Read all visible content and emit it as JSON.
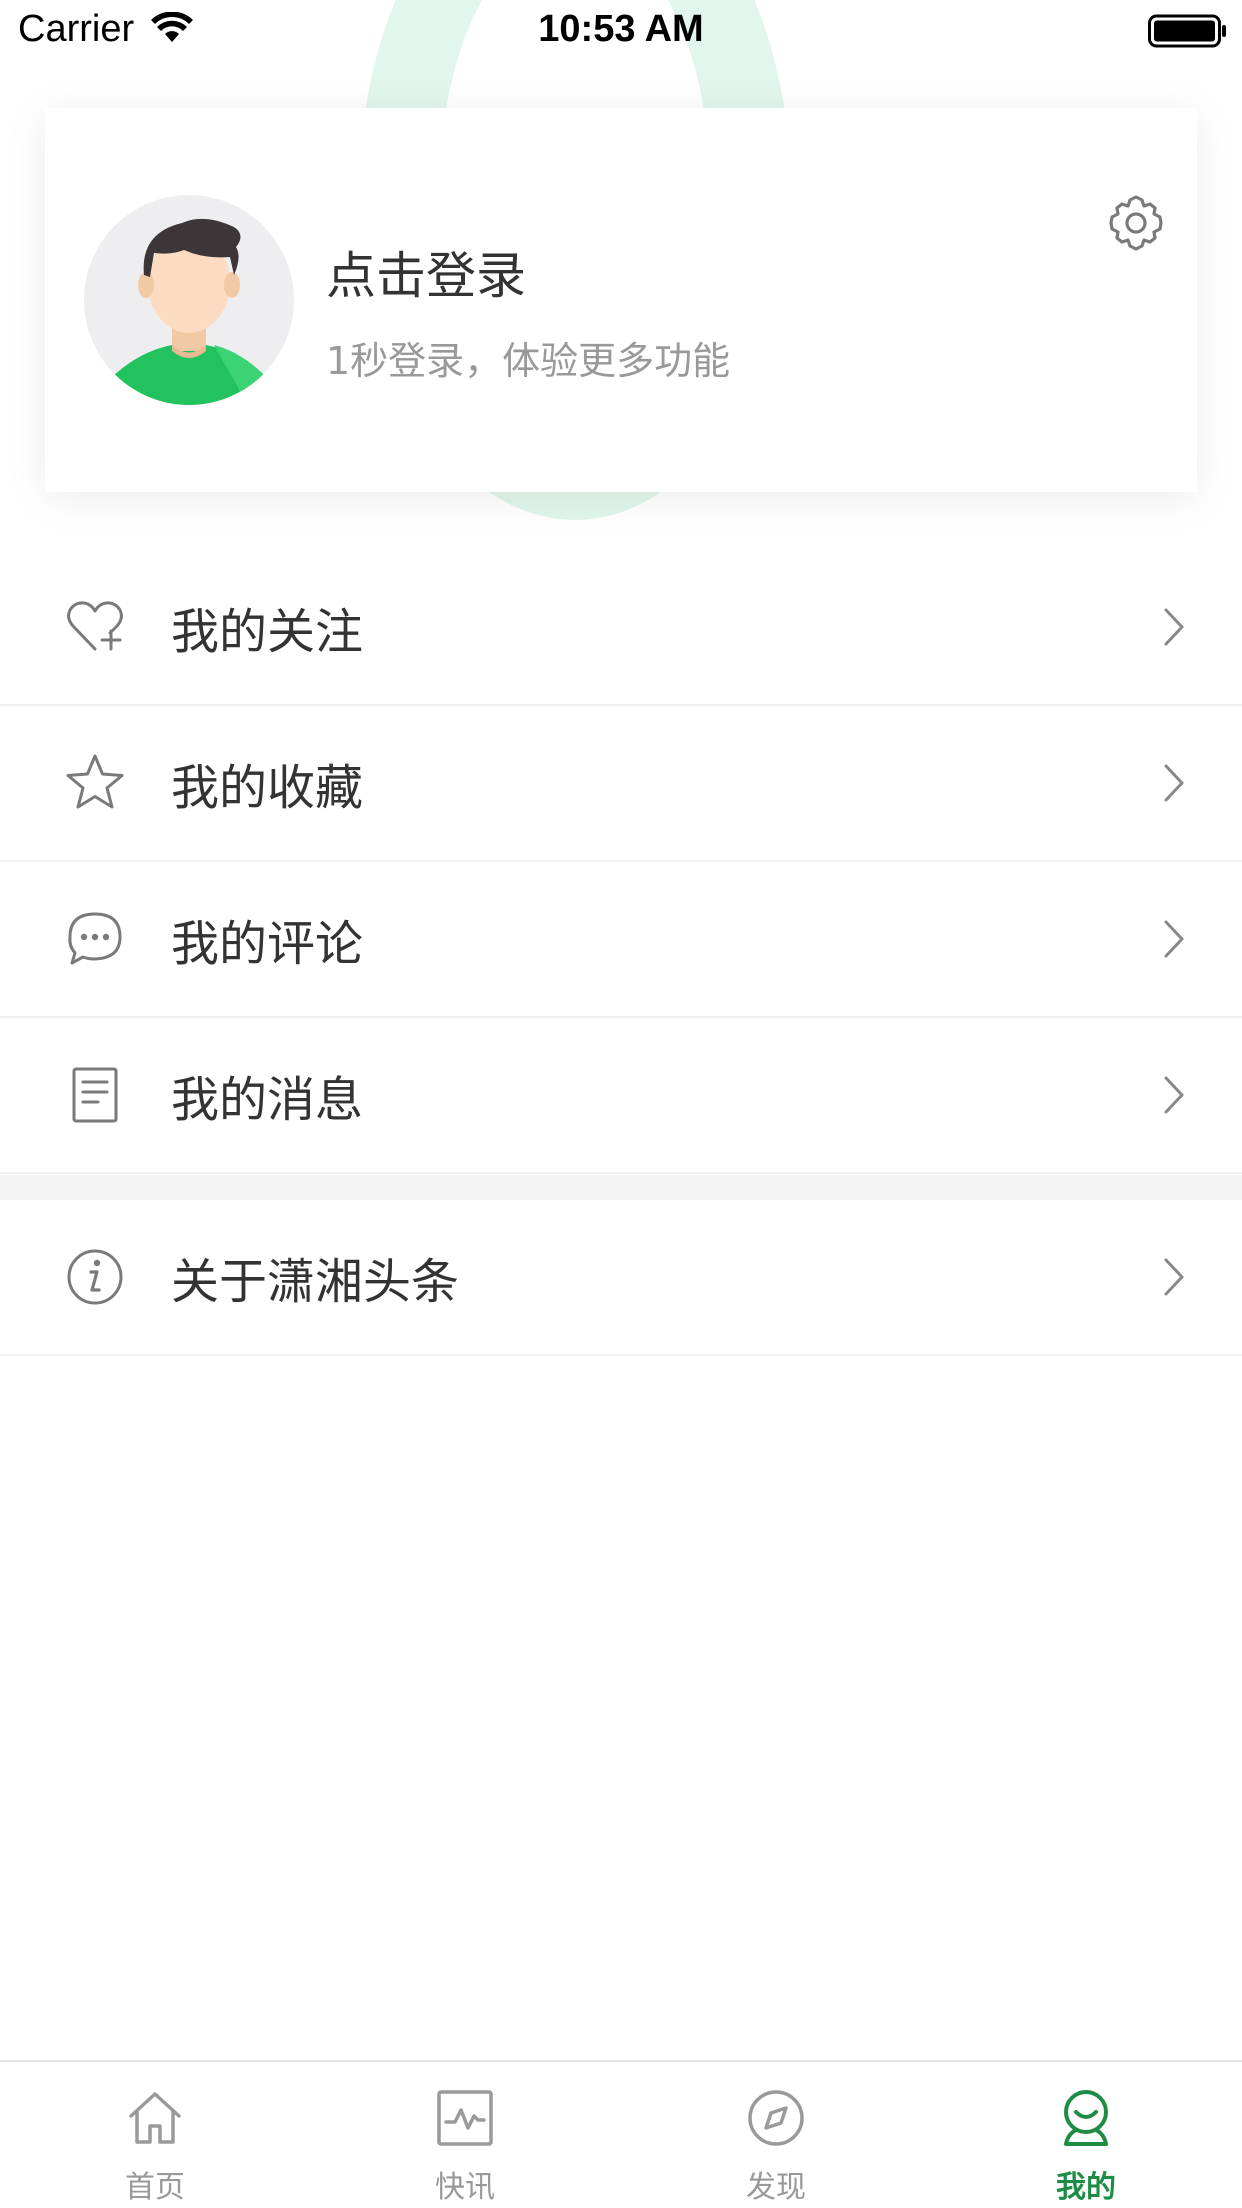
{
  "status_bar": {
    "carrier": "Carrier",
    "time": "10:53 AM"
  },
  "profile": {
    "login_title": "点击登录",
    "login_subtitle": "1秒登录，体验更多功能",
    "settings_icon": "gear-icon",
    "avatar_icon": "default-avatar"
  },
  "menu": {
    "group_main": [
      {
        "label": "我的关注",
        "icon": "heart-plus-icon"
      },
      {
        "label": "我的收藏",
        "icon": "star-icon"
      },
      {
        "label": "我的评论",
        "icon": "comment-icon"
      },
      {
        "label": "我的消息",
        "icon": "document-icon"
      }
    ],
    "group_about": [
      {
        "label": "关于潇湘头条",
        "icon": "info-icon"
      }
    ]
  },
  "tab_bar": {
    "tabs": [
      {
        "label": "首页",
        "icon": "home-icon",
        "active": false
      },
      {
        "label": "快讯",
        "icon": "pulse-chart-icon",
        "active": false
      },
      {
        "label": "发现",
        "icon": "compass-icon",
        "active": false
      },
      {
        "label": "我的",
        "icon": "user-smile-icon",
        "active": true
      }
    ]
  },
  "colors": {
    "accent": "#1e8c45",
    "avatar_shirt": "#22c35e",
    "text_primary": "#333333",
    "text_secondary": "#999999",
    "icon_gray": "#7a7a7a"
  }
}
